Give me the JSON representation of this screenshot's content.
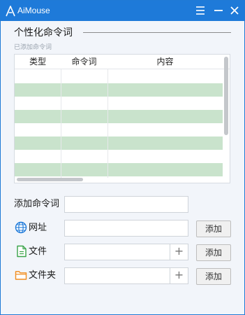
{
  "app": {
    "title": "AiMouse"
  },
  "section": {
    "title": "个性化命令词",
    "sub_label": "已添加命令词"
  },
  "table": {
    "headers": [
      "类型",
      "命令词",
      "内容"
    ],
    "rows": [
      {
        "type": "",
        "command": "",
        "content": ""
      },
      {
        "type": "",
        "command": "",
        "content": ""
      },
      {
        "type": "",
        "command": "",
        "content": ""
      },
      {
        "type": "",
        "command": "",
        "content": ""
      },
      {
        "type": "",
        "command": "",
        "content": ""
      },
      {
        "type": "",
        "command": "",
        "content": ""
      },
      {
        "type": "",
        "command": "",
        "content": ""
      },
      {
        "type": "",
        "command": "",
        "content": ""
      }
    ]
  },
  "form": {
    "command_label": "添加命令词",
    "command_value": "",
    "url_label": "网址",
    "url_value": "",
    "file_label": "文件",
    "file_value": "",
    "folder_label": "文件夹",
    "folder_value": "",
    "plus": "+",
    "add": "添加"
  },
  "icons": {
    "logo": "aimouse-logo-icon",
    "menu": "menu-icon",
    "minimize": "minimize-icon",
    "close": "close-icon",
    "url": "globe-icon",
    "file": "file-icon",
    "folder": "folder-icon"
  },
  "colors": {
    "titlebar": "#1e7ad9",
    "row_highlight": "#c9e3cc",
    "background": "#f2f5fa"
  }
}
